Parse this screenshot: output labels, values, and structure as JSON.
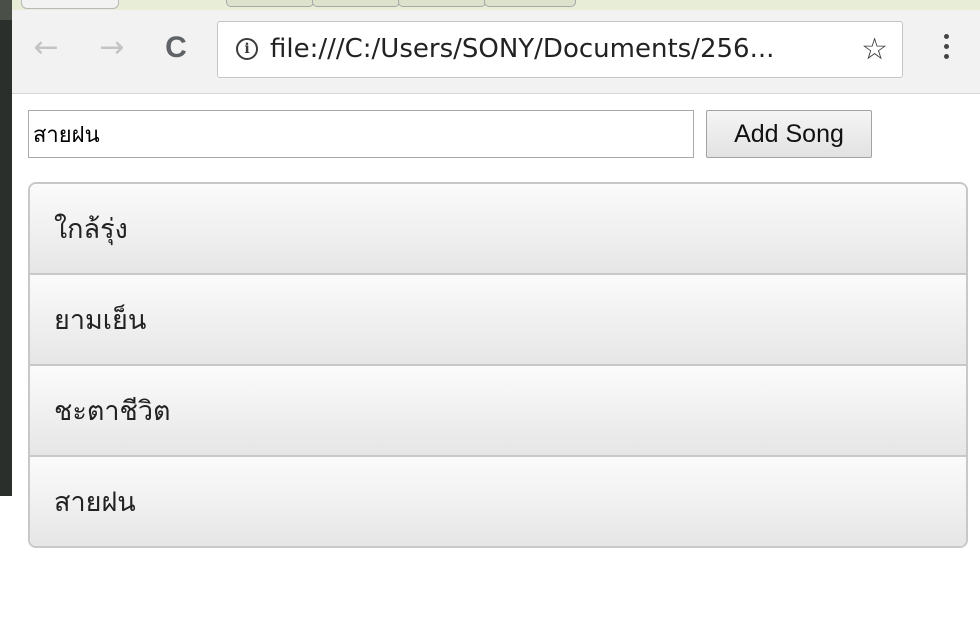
{
  "browser": {
    "url": "file:///C:/Users/SONY/Documents/256...",
    "back_icon": "←",
    "forward_icon": "→",
    "reload_icon": "C",
    "info_icon": "i",
    "star_icon": "☆"
  },
  "form": {
    "input_value": "สายฝน",
    "add_button_label": "Add Song"
  },
  "songs": [
    {
      "title": "ใกล้รุ่ง"
    },
    {
      "title": "ยามเย็น"
    },
    {
      "title": "ชะตาชีวิต"
    },
    {
      "title": "สายฝน"
    }
  ]
}
